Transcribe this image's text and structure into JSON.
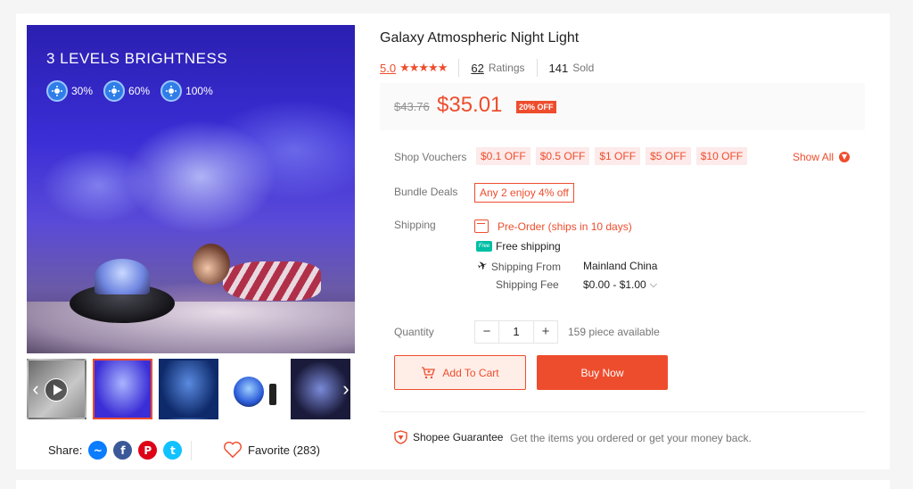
{
  "product": {
    "title": "Galaxy Atmospheric Night Light",
    "rating": "5.0",
    "stars": "★★★★★",
    "ratings_count": "62",
    "ratings_label": "Ratings",
    "sold_count": "141",
    "sold_label": "Sold"
  },
  "image": {
    "headline": "3 LEVELS BRIGHTNESS",
    "levels": [
      "30%",
      "60%",
      "100%"
    ],
    "thumbnail_count": 5,
    "active_thumbnail": 2
  },
  "price": {
    "original": "$43.76",
    "current": "$35.01",
    "discount_badge": "20% OFF"
  },
  "vouchers": {
    "label": "Shop Vouchers",
    "items": [
      "$0.1 OFF",
      "$0.5 OFF",
      "$1 OFF",
      "$5 OFF",
      "$10 OFF"
    ],
    "show_all": "Show All"
  },
  "bundle": {
    "label": "Bundle Deals",
    "deal": "Any 2 enjoy 4% off"
  },
  "shipping": {
    "label": "Shipping",
    "preorder": "Pre-Order (ships in 10 days)",
    "free_badge": "Free",
    "free_shipping": "Free shipping",
    "from_label": "Shipping From",
    "from_value": "Mainland China",
    "fee_label": "Shipping Fee",
    "fee_value": "$0.00 - $1.00"
  },
  "quantity": {
    "label": "Quantity",
    "value": "1",
    "minus": "−",
    "plus": "+",
    "available": "159 piece available"
  },
  "actions": {
    "add_to_cart": "Add To Cart",
    "buy_now": "Buy Now"
  },
  "guarantee": {
    "title": "Shopee Guarantee",
    "text": "Get the items you ordered or get your money back."
  },
  "social": {
    "share_label": "Share:",
    "favorite_label": "Favorite (283)"
  },
  "colors": {
    "accent": "#ee4d2d",
    "voucher_bg": "#fdeaea",
    "free_shipping": "#00bfa5"
  },
  "icons": [
    "messenger-icon",
    "facebook-icon",
    "pinterest-icon",
    "twitter-icon",
    "heart-icon",
    "calendar-icon",
    "truck-icon",
    "plane-icon",
    "cart-icon",
    "shield-icon",
    "chevron-down-icon",
    "play-icon",
    "arrow-left-icon",
    "arrow-right-icon",
    "sun-icon"
  ]
}
